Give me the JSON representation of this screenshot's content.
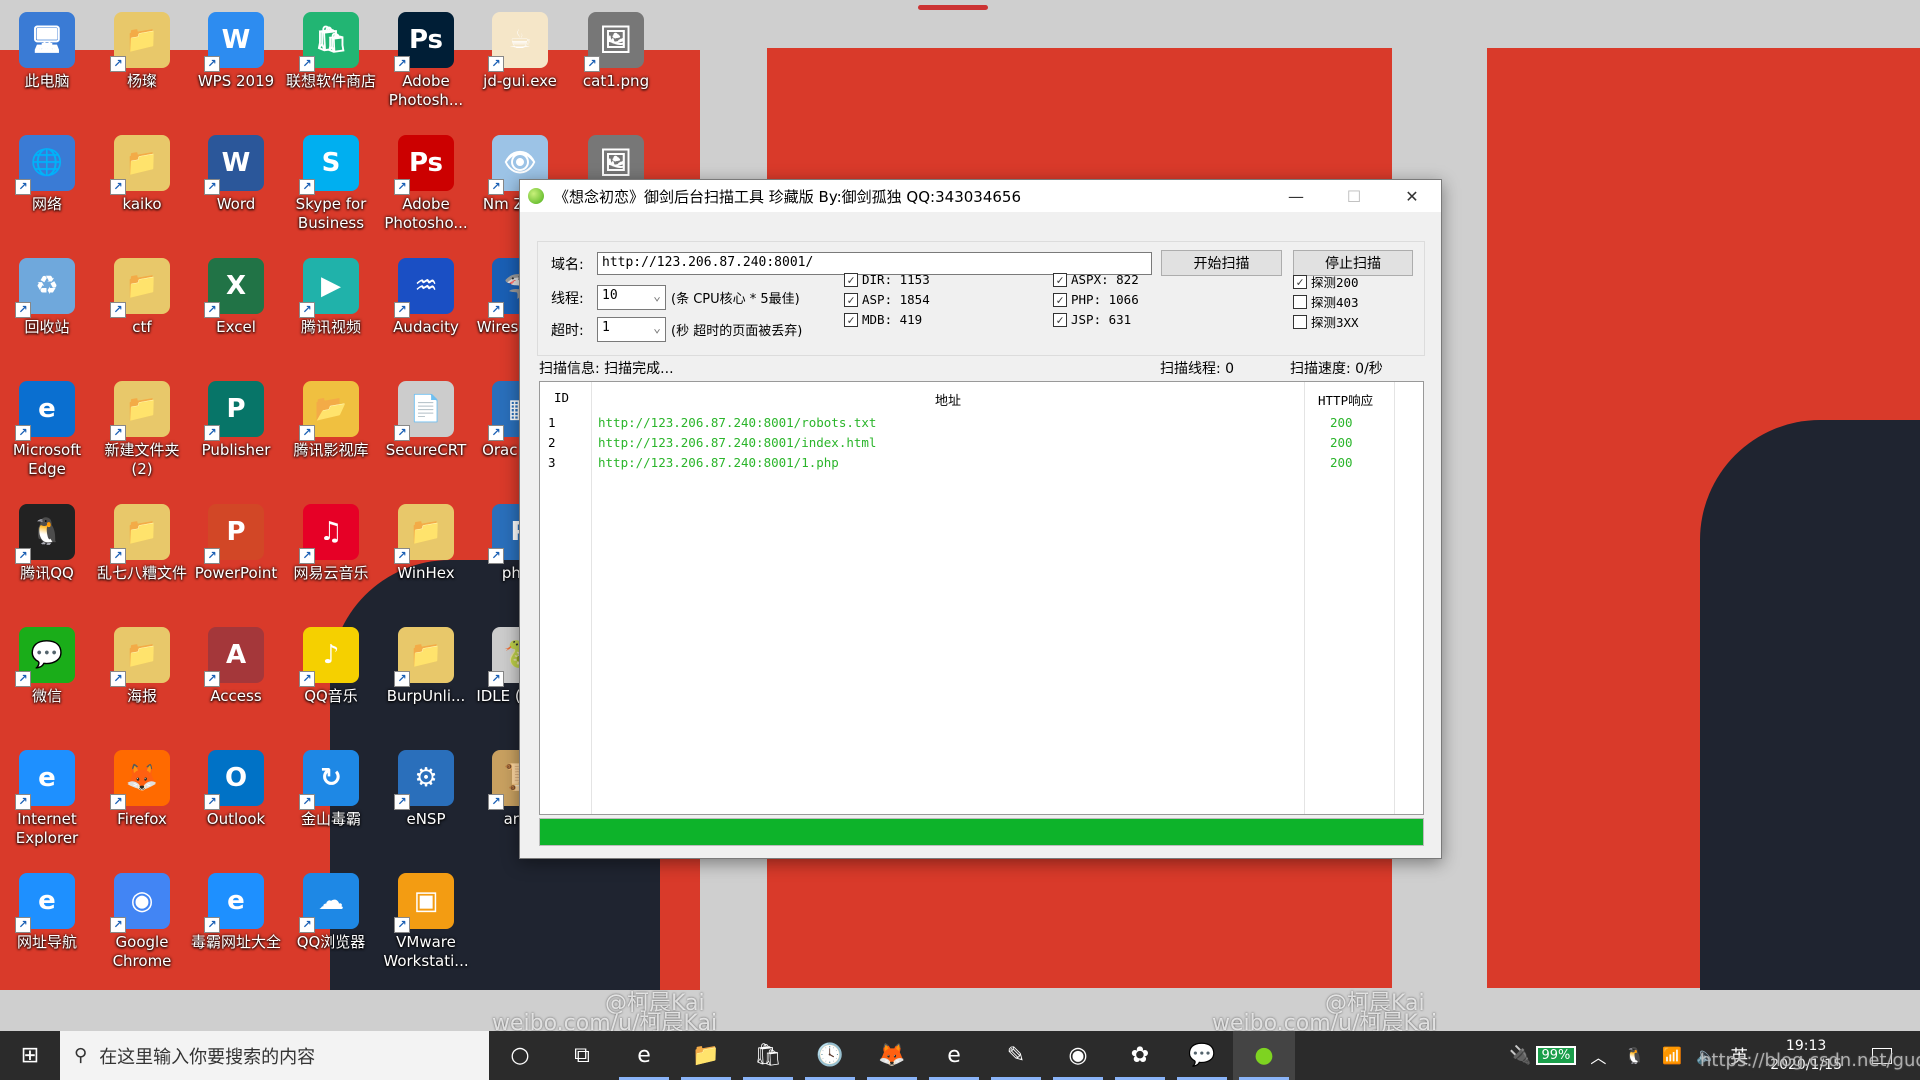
{
  "desktop": {
    "icons": [
      [
        "此电脑",
        "网络",
        "回收站",
        "Microsoft Edge",
        "腾讯QQ",
        "微信",
        "Internet Explorer",
        "网址导航"
      ],
      [
        "杨璨",
        "kaiko",
        "ctf",
        "新建文件夹 (2)",
        "乱七八糟文件",
        "海报",
        "Firefox",
        "Google Chrome"
      ],
      [
        "WPS 2019",
        "Word",
        "Excel",
        "Publisher",
        "PowerPoint",
        "Access",
        "Outlook",
        "毒霸网址大全"
      ],
      [
        "联想软件商店",
        "Skype for Business",
        "腾讯视频",
        "腾讯影视库",
        "网易云音乐",
        "QQ音乐",
        "金山毒霸",
        "QQ浏览器"
      ],
      [
        "Adobe Photosh...",
        "Adobe Photosho...",
        "Audacity",
        "SecureCRT",
        "WinHex",
        "BurpUnli...",
        "eNSP",
        "VMware Workstati..."
      ],
      [
        "jd-gui.exe",
        "Nm Zenm",
        "Wires - 快捷",
        "Orac Virtu",
        "phps",
        "IDLE ( 3.7 6",
        "arch",
        ""
      ],
      [
        "cat1.png",
        "",
        "",
        "",
        "",
        "",
        "",
        ""
      ]
    ],
    "icon_glyphs": [
      [
        "🖥",
        "🌐",
        "♻",
        "e",
        "🐧",
        "💬",
        "e",
        "e"
      ],
      [
        "📁",
        "📁",
        "📁",
        "📁",
        "📁",
        "📁",
        "🦊",
        "◉"
      ],
      [
        "W",
        "W",
        "X",
        "P",
        "P",
        "A",
        "O",
        "e"
      ],
      [
        "🛍",
        "S",
        "▶",
        "📂",
        "♫",
        "♪",
        "↻",
        "☁"
      ],
      [
        "Ps",
        "Ps",
        "♒",
        "📄",
        "📁",
        "📁",
        "⚙",
        "▣"
      ],
      [
        "☕",
        "👁",
        "🦈",
        "▦",
        "P",
        "🐍",
        "📜",
        ""
      ],
      [
        "🖼",
        "🖼",
        "",
        "",
        "",
        "",
        "",
        ""
      ]
    ],
    "icon_colors": [
      [
        "#3a7bd5",
        "#3a7bd5",
        "#6fa8dc",
        "#0a6fd0",
        "#222",
        "#1aad19",
        "#1e90ff",
        "#1e90ff"
      ],
      [
        "#e8c86a",
        "#e8c86a",
        "#e8c86a",
        "#e8c86a",
        "#e8c86a",
        "#e8c86a",
        "#ff6a00",
        "#4285f4"
      ],
      [
        "#2d8cf0",
        "#2b579a",
        "#217346",
        "#077568",
        "#d24726",
        "#a4373a",
        "#0072c6",
        "#1e90ff"
      ],
      [
        "#22b573",
        "#00aff0",
        "#20b2aa",
        "#f0c040",
        "#e60026",
        "#f5d000",
        "#1e88e5",
        "#1e88e5"
      ],
      [
        "#001e36",
        "#c00",
        "#1a4fc4",
        "#ccc",
        "#e8c86a",
        "#e8c86a",
        "#2a6fbb",
        "#f39c12"
      ],
      [
        "#f5e6c8",
        "#9cc3e6",
        "#1a5fb4",
        "#2a6fbb",
        "#2a6fbb",
        "#ccc",
        "#c8a060",
        ""
      ],
      [
        "#777",
        "#777",
        "",
        "",
        "",
        "",
        "",
        ""
      ]
    ],
    "watermark_user": "@柯晨Kai",
    "watermark_url": "weibo.com/u/柯晨Kai",
    "watermark_blog": "https://blog.csdn.net/gudugeji"
  },
  "window": {
    "title": "《想念初恋》御剑后台扫描工具 珍藏版 By:御剑孤独 QQ:343034656",
    "minimize": "—",
    "maximize": "☐",
    "close": "✕",
    "domain_label": "域名:",
    "domain_value": "http://123.206.87.240:8001/",
    "start_button": "开始扫描",
    "stop_button": "停止扫描",
    "threads_label": "线程:",
    "threads_value": "10",
    "threads_hint": "(条 CPU核心 * 5最佳)",
    "timeout_label": "超时:",
    "timeout_value": "1",
    "timeout_hint": "(秒 超时的页面被丢弃)",
    "checkboxes": [
      {
        "label": "DIR: 1153",
        "checked": true
      },
      {
        "label": "ASP: 1854",
        "checked": true
      },
      {
        "label": "MDB: 419",
        "checked": true
      },
      {
        "label": "ASPX: 822",
        "checked": true
      },
      {
        "label": "PHP: 1066",
        "checked": true
      },
      {
        "label": "JSP: 631",
        "checked": true
      },
      {
        "label": "探测200",
        "checked": true
      },
      {
        "label": "探测403",
        "checked": false
      },
      {
        "label": "探测3XX",
        "checked": false
      }
    ],
    "scan_info": "扫描信息: 扫描完成...",
    "scan_threads": "扫描线程: 0",
    "scan_speed": "扫描速度: 0/秒",
    "table": {
      "headers": [
        "ID",
        "地址",
        "HTTP响应"
      ],
      "rows": [
        [
          "1",
          "http://123.206.87.240:8001/robots.txt",
          "200"
        ],
        [
          "2",
          "http://123.206.87.240:8001/index.html",
          "200"
        ],
        [
          "3",
          "http://123.206.87.240:8001/1.php",
          "200"
        ]
      ]
    },
    "progress_percent": 100,
    "progress_color": "#0db32a"
  },
  "taskbar": {
    "search_placeholder": "在这里输入你要搜索的内容",
    "apps": [
      "cortana",
      "task-view",
      "edge",
      "file-explorer",
      "store",
      "clock-app",
      "firefox",
      "internet-explorer",
      "notepad",
      "chrome",
      "baidu-netdisk",
      "wechat",
      "yujian-scanner"
    ],
    "app_glyphs": [
      "○",
      "⧉",
      "e",
      "📁",
      "🛍",
      "🕓",
      "🦊",
      "e",
      "✎",
      "◉",
      "✿",
      "💬",
      "●"
    ],
    "battery": "99%",
    "ime": "英",
    "time": "19:13",
    "date": "2020/1/15"
  }
}
